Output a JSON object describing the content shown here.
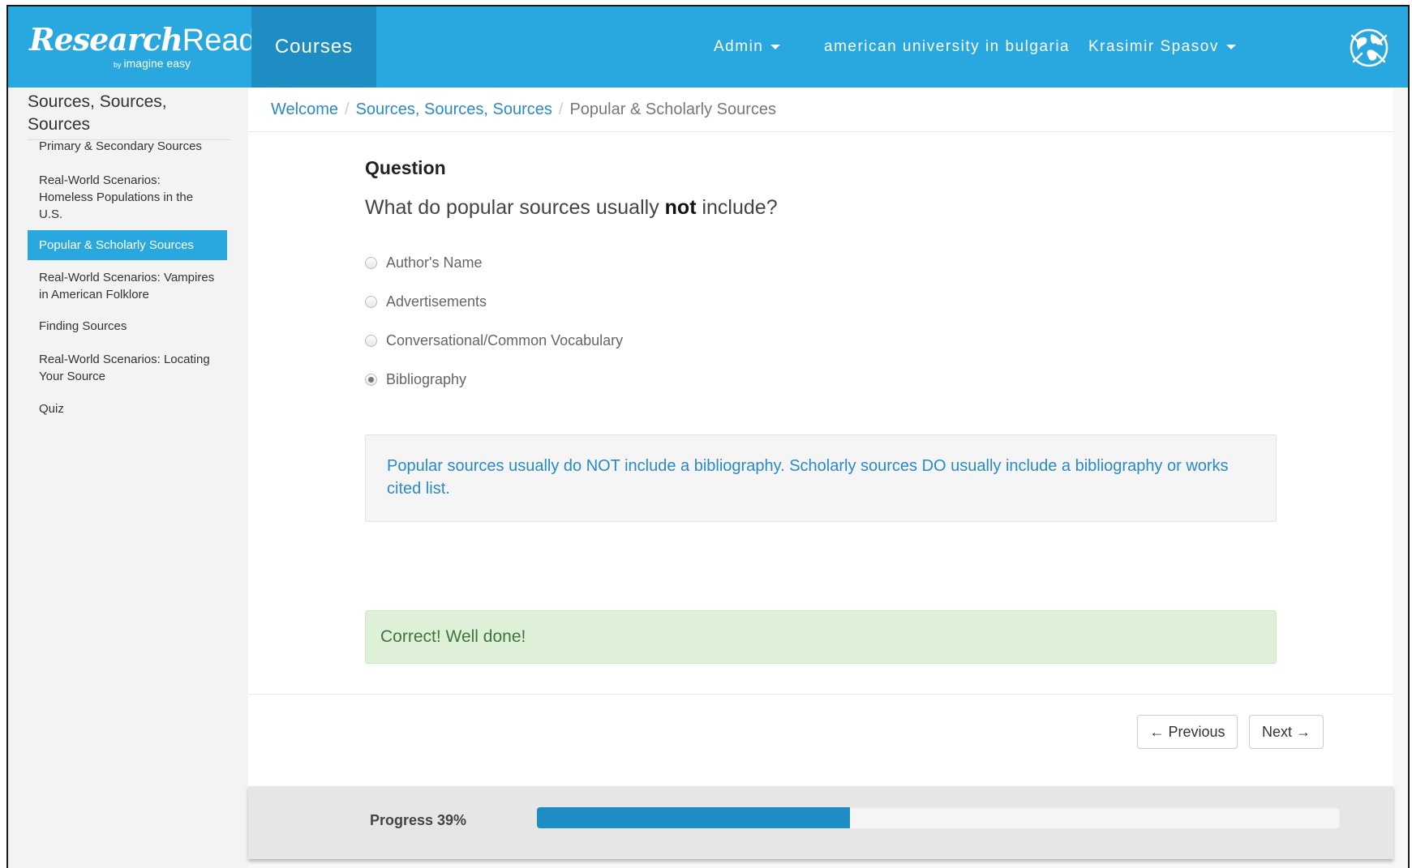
{
  "brand": {
    "logo_script": "Research",
    "logo_plain": "Ready",
    "logo_tm": "™",
    "logo_by": "by",
    "logo_company": "imagine easy"
  },
  "topnav": {
    "courses_label": "Courses",
    "admin_label": "Admin",
    "institution_label": "american university in bulgaria",
    "user_label": "Krasimir Spasov",
    "avatar_icon": "globe-icon"
  },
  "sidebar": {
    "title": "Sources, Sources, Sources",
    "items": [
      {
        "label": "Primary & Secondary Sources",
        "active": false
      },
      {
        "label": "Real-World Scenarios: Homeless Populations in the U.S.",
        "active": false
      },
      {
        "label": "Popular & Scholarly Sources",
        "active": true
      },
      {
        "label": "Real-World Scenarios: Vampires in American Folklore",
        "active": false
      },
      {
        "label": "Finding Sources",
        "active": false
      },
      {
        "label": "Real-World Scenarios: Locating Your Source",
        "active": false
      },
      {
        "label": "Quiz",
        "active": false
      }
    ]
  },
  "breadcrumb": {
    "items": [
      "Welcome",
      "Sources, Sources, Sources",
      "Popular & Scholarly Sources"
    ],
    "separator": "/"
  },
  "question": {
    "heading": "Question",
    "text_before": "What do popular sources usually ",
    "text_emphasis": "not",
    "text_after": " include?",
    "options": [
      {
        "label": "Author's Name",
        "selected": false
      },
      {
        "label": "Advertisements",
        "selected": false
      },
      {
        "label": "Conversational/Common Vocabulary",
        "selected": false
      },
      {
        "label": "Bibliography",
        "selected": true
      }
    ],
    "explanation": "Popular sources usually do NOT include a bibliography. Scholarly sources DO usually include a bibliography or works cited list."
  },
  "feedback": {
    "message": "Correct! Well done!"
  },
  "navigation": {
    "previous_label": "← Previous",
    "next_label": "Next →"
  },
  "progress": {
    "label": "Progress 39%",
    "percent": 39
  },
  "colors": {
    "nav_blue": "#29a8df",
    "nav_active": "#1e8dc4",
    "link": "#2a8ac6",
    "success_bg": "#dff0d8",
    "success_text": "#3c763d"
  }
}
